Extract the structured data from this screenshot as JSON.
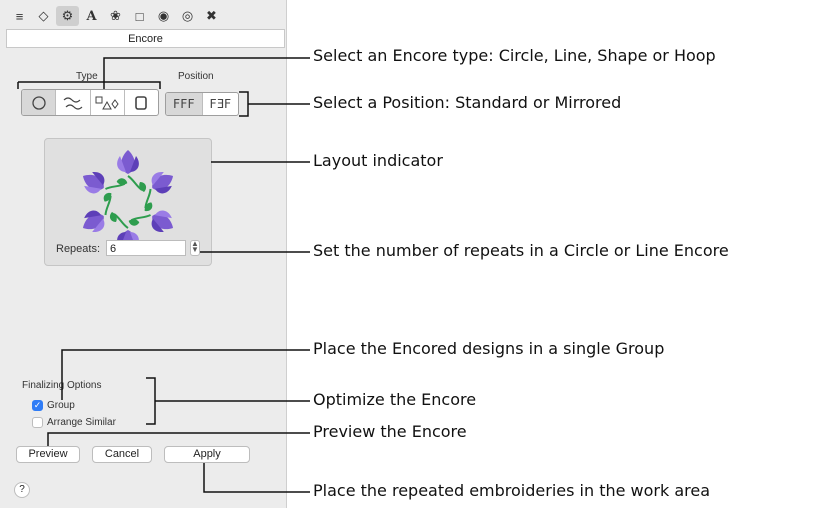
{
  "panel": {
    "toolbar_icons": [
      "list-icon",
      "diamond-icon",
      "gear-icon",
      "text-icon",
      "thread-icon",
      "dashed-rect-icon",
      "circle-fill-icon",
      "target-icon",
      "tools-icon"
    ],
    "title": "Encore",
    "type_label": "Type",
    "position_label": "Position",
    "type_buttons": [
      "circle",
      "line",
      "shape",
      "hoop"
    ],
    "position_buttons": [
      "FFF",
      "FƎF"
    ],
    "repeats_label": "Repeats:",
    "repeats_value": "6",
    "finalizing_label": "Finalizing Options",
    "group_label": "Group",
    "group_checked": true,
    "arrange_label": "Arrange Similar",
    "arrange_checked": false,
    "preview_label": "Preview",
    "cancel_label": "Cancel",
    "apply_label": "Apply",
    "help_label": "?"
  },
  "callouts": {
    "type": "Select an Encore type: Circle, Line, Shape or Hoop",
    "position": "Select a Position: Standard or Mirrored",
    "layout": "Layout indicator",
    "repeats": "Set the number of repeats in a Circle or Line Encore",
    "group": "Place the Encored designs in a single Group",
    "optimize": "Optimize the Encore",
    "preview": "Preview the Encore",
    "apply": "Place the repeated embroideries in the work area"
  },
  "colors": {
    "flower_purple": "#7b5bd0",
    "leaf_green": "#2e9d4e",
    "accent_blue": "#2f7cf6"
  }
}
